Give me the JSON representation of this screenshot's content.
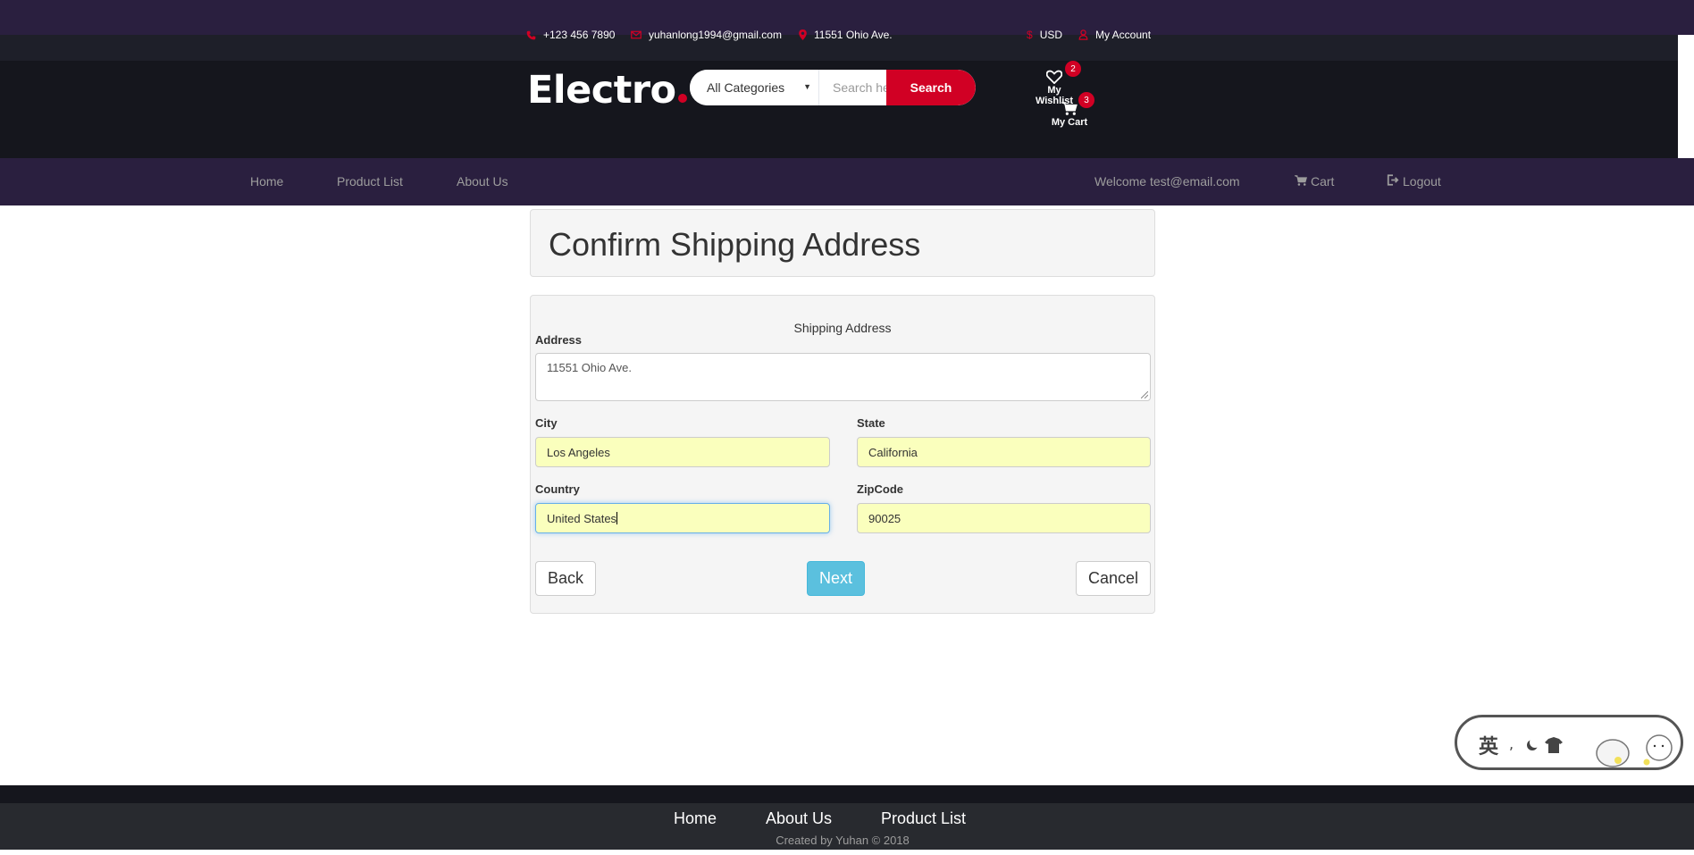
{
  "topbar": {
    "phone": "+123 456 7890",
    "email": "yuhanlong1994@gmail.com",
    "address": "11551 Ohio Ave.",
    "currency": "USD",
    "account": "My Account"
  },
  "header": {
    "logo": "Electro",
    "category_select": "All Categories",
    "search_placeholder": "Search here",
    "search_button": "Search",
    "wishlist_label": "My Wishlist",
    "wishlist_count": "2",
    "cart_label": "My Cart",
    "cart_count": "3"
  },
  "nav": {
    "home": "Home",
    "product_list": "Product List",
    "about_us": "About Us",
    "welcome": "Welcome test@email.com",
    "cart": "Cart",
    "logout": "Logout"
  },
  "page": {
    "title": "Confirm Shipping Address",
    "section_title": "Shipping Address"
  },
  "form": {
    "address_label": "Address",
    "address_value": "11551 Ohio Ave.",
    "city_label": "City",
    "city_value": "Los Angeles",
    "state_label": "State",
    "state_value": "California",
    "country_label": "Country",
    "country_value": "United States",
    "zip_label": "ZipCode",
    "zip_value": "90025",
    "back_button": "Back",
    "next_button": "Next",
    "cancel_button": "Cancel"
  },
  "footer": {
    "home": "Home",
    "about_us": "About Us",
    "product_list": "Product List",
    "credit": "Created by Yuhan © 2018"
  },
  "ime": {
    "text": "英",
    "icons": [
      "punctuation-icon",
      "moon-icon",
      "shirt-icon",
      "mascot-icon"
    ]
  },
  "colors": {
    "brand_red": "#d10024",
    "top_purple": "#2a1f3f",
    "header_dark": "#15161d",
    "autofill_yellow": "#faffbd",
    "info_blue": "#5bc0de"
  }
}
